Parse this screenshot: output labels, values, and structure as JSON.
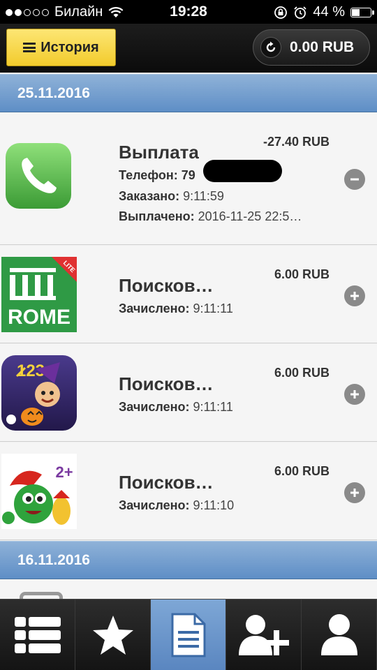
{
  "status_bar": {
    "carrier": "Билайн",
    "time": "19:28",
    "battery": "44 %",
    "signal_filled": 2,
    "signal_total": 5,
    "battery_level": 0.44
  },
  "header": {
    "history_label": "История",
    "balance": "0.00 RUB"
  },
  "groups": [
    {
      "date": "25.11.2016",
      "items": [
        {
          "icon": "phone-app-icon",
          "title": "Выплата",
          "amount": "-27.40 RUB",
          "action": "minus",
          "details": [
            {
              "label": "Телефон:",
              "value": "79"
            },
            {
              "label": "Заказано:",
              "value": "9:11:59"
            },
            {
              "label": "Выплачено:",
              "value": "2016-11-25 22:5…"
            }
          ]
        },
        {
          "icon": "rome-lite-app-icon",
          "icon_text": "ROME",
          "icon_badge": "LITE",
          "title": "Поисков…",
          "amount": "6.00 RUB",
          "action": "plus",
          "details": [
            {
              "label": "Зачислено:",
              "value": "9:11:11"
            }
          ]
        },
        {
          "icon": "halloween-123-app-icon",
          "icon_text": "123",
          "title": "Поисков…",
          "amount": "6.00 RUB",
          "action": "plus",
          "details": [
            {
              "label": "Зачислено:",
              "value": "9:11:11"
            }
          ]
        },
        {
          "icon": "christmas-monster-app-icon",
          "icon_text": "2+",
          "title": "Поисков…",
          "amount": "6.00 RUB",
          "action": "plus",
          "details": [
            {
              "label": "Зачислено:",
              "value": "9:11:10"
            }
          ]
        }
      ]
    },
    {
      "date": "16.11.2016",
      "items": []
    }
  ],
  "tabs": [
    {
      "name": "list-icon",
      "active": false
    },
    {
      "name": "star-icon",
      "active": false
    },
    {
      "name": "document-icon",
      "active": true
    },
    {
      "name": "add-user-icon",
      "active": false
    },
    {
      "name": "user-icon",
      "active": false
    }
  ]
}
